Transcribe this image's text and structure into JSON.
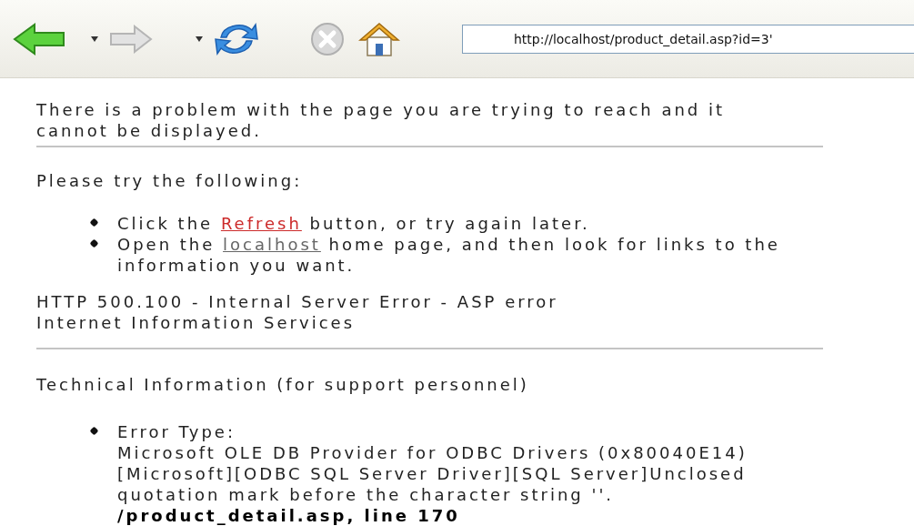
{
  "toolbar": {
    "buttons": [
      {
        "kind": "back",
        "disabled": false
      },
      {
        "kind": "caret"
      },
      {
        "kind": "forward",
        "disabled": true
      },
      {
        "kind": "caret"
      },
      {
        "kind": "refresh",
        "disabled": false
      },
      {
        "kind": "stop",
        "disabled": true
      },
      {
        "kind": "home",
        "disabled": false
      }
    ],
    "address": {
      "value": "http://localhost/product_detail.asp?id=3'"
    }
  },
  "page": {
    "intro": "There is a problem with the page you are trying to reach and it cannot be displayed.",
    "suggestions_heading": "Please try the following:",
    "suggestions": [
      {
        "before": "Click the ",
        "link": {
          "text": "Refresh",
          "visited": false
        },
        "after": " button, or try again later."
      },
      {
        "before": "Open the ",
        "link": {
          "text": "localhost",
          "visited": true
        },
        "after": " home page, and then look for links to the information you want."
      }
    ],
    "error_lines": [
      "HTTP 500.100 - Internal Server Error - ASP error",
      "Internet Information Services"
    ],
    "tech_heading": "Technical Information (for support personnel)",
    "tech_items": [
      {
        "label": "Error Type:",
        "lines": [
          "Microsoft OLE DB Provider for ODBC Drivers (0x80040E14)",
          "[Microsoft][ODBC SQL Server Driver][SQL Server]Unclosed",
          "quotation mark before the character string ''."
        ],
        "location": "/product_detail.asp, line 170"
      }
    ]
  }
}
